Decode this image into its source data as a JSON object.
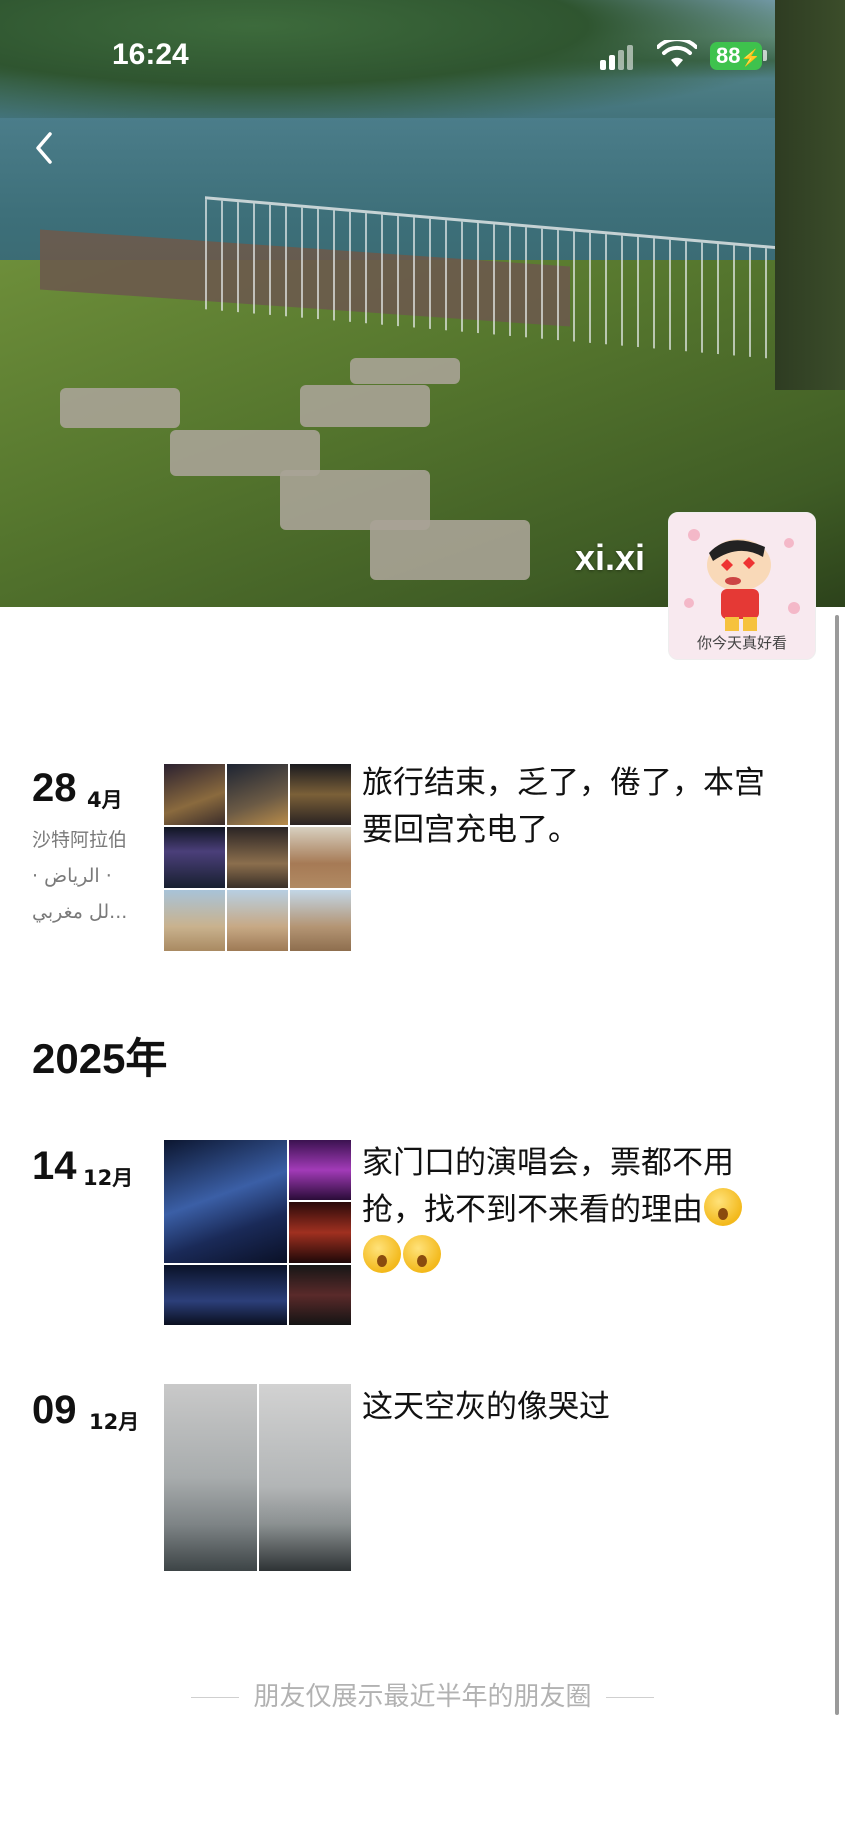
{
  "status_bar": {
    "time": "16:24",
    "battery": "88"
  },
  "profile": {
    "username": "xi.xi",
    "avatar_caption": "你今天真好看"
  },
  "posts": [
    {
      "day": "28",
      "month": "4月",
      "location": [
        "沙特阿拉伯",
        "· الرياض ·",
        "لل مغربي..."
      ],
      "text": "旅行结束，乏了，倦了，本宫要回宫充电了。",
      "image_count": 9
    },
    {
      "day": "14",
      "month": "12月",
      "text": "家门口的演唱会，票都不用抢，找不到不来看的理由",
      "emoji_count": 3,
      "image_count": 8
    },
    {
      "day": "09",
      "month": "12月",
      "text": "这天空灰的像哭过",
      "image_count": 2
    }
  ],
  "year_header": "2025年",
  "footer": "朋友仅展示最近半年的朋友圈",
  "icons": [
    "back-icon",
    "signal-icon",
    "wifi-icon",
    "battery-icon"
  ],
  "colors": {
    "battery": "#3ec24d",
    "footer_text": "#b2b2b2",
    "location_text": "#7a7a7a"
  }
}
